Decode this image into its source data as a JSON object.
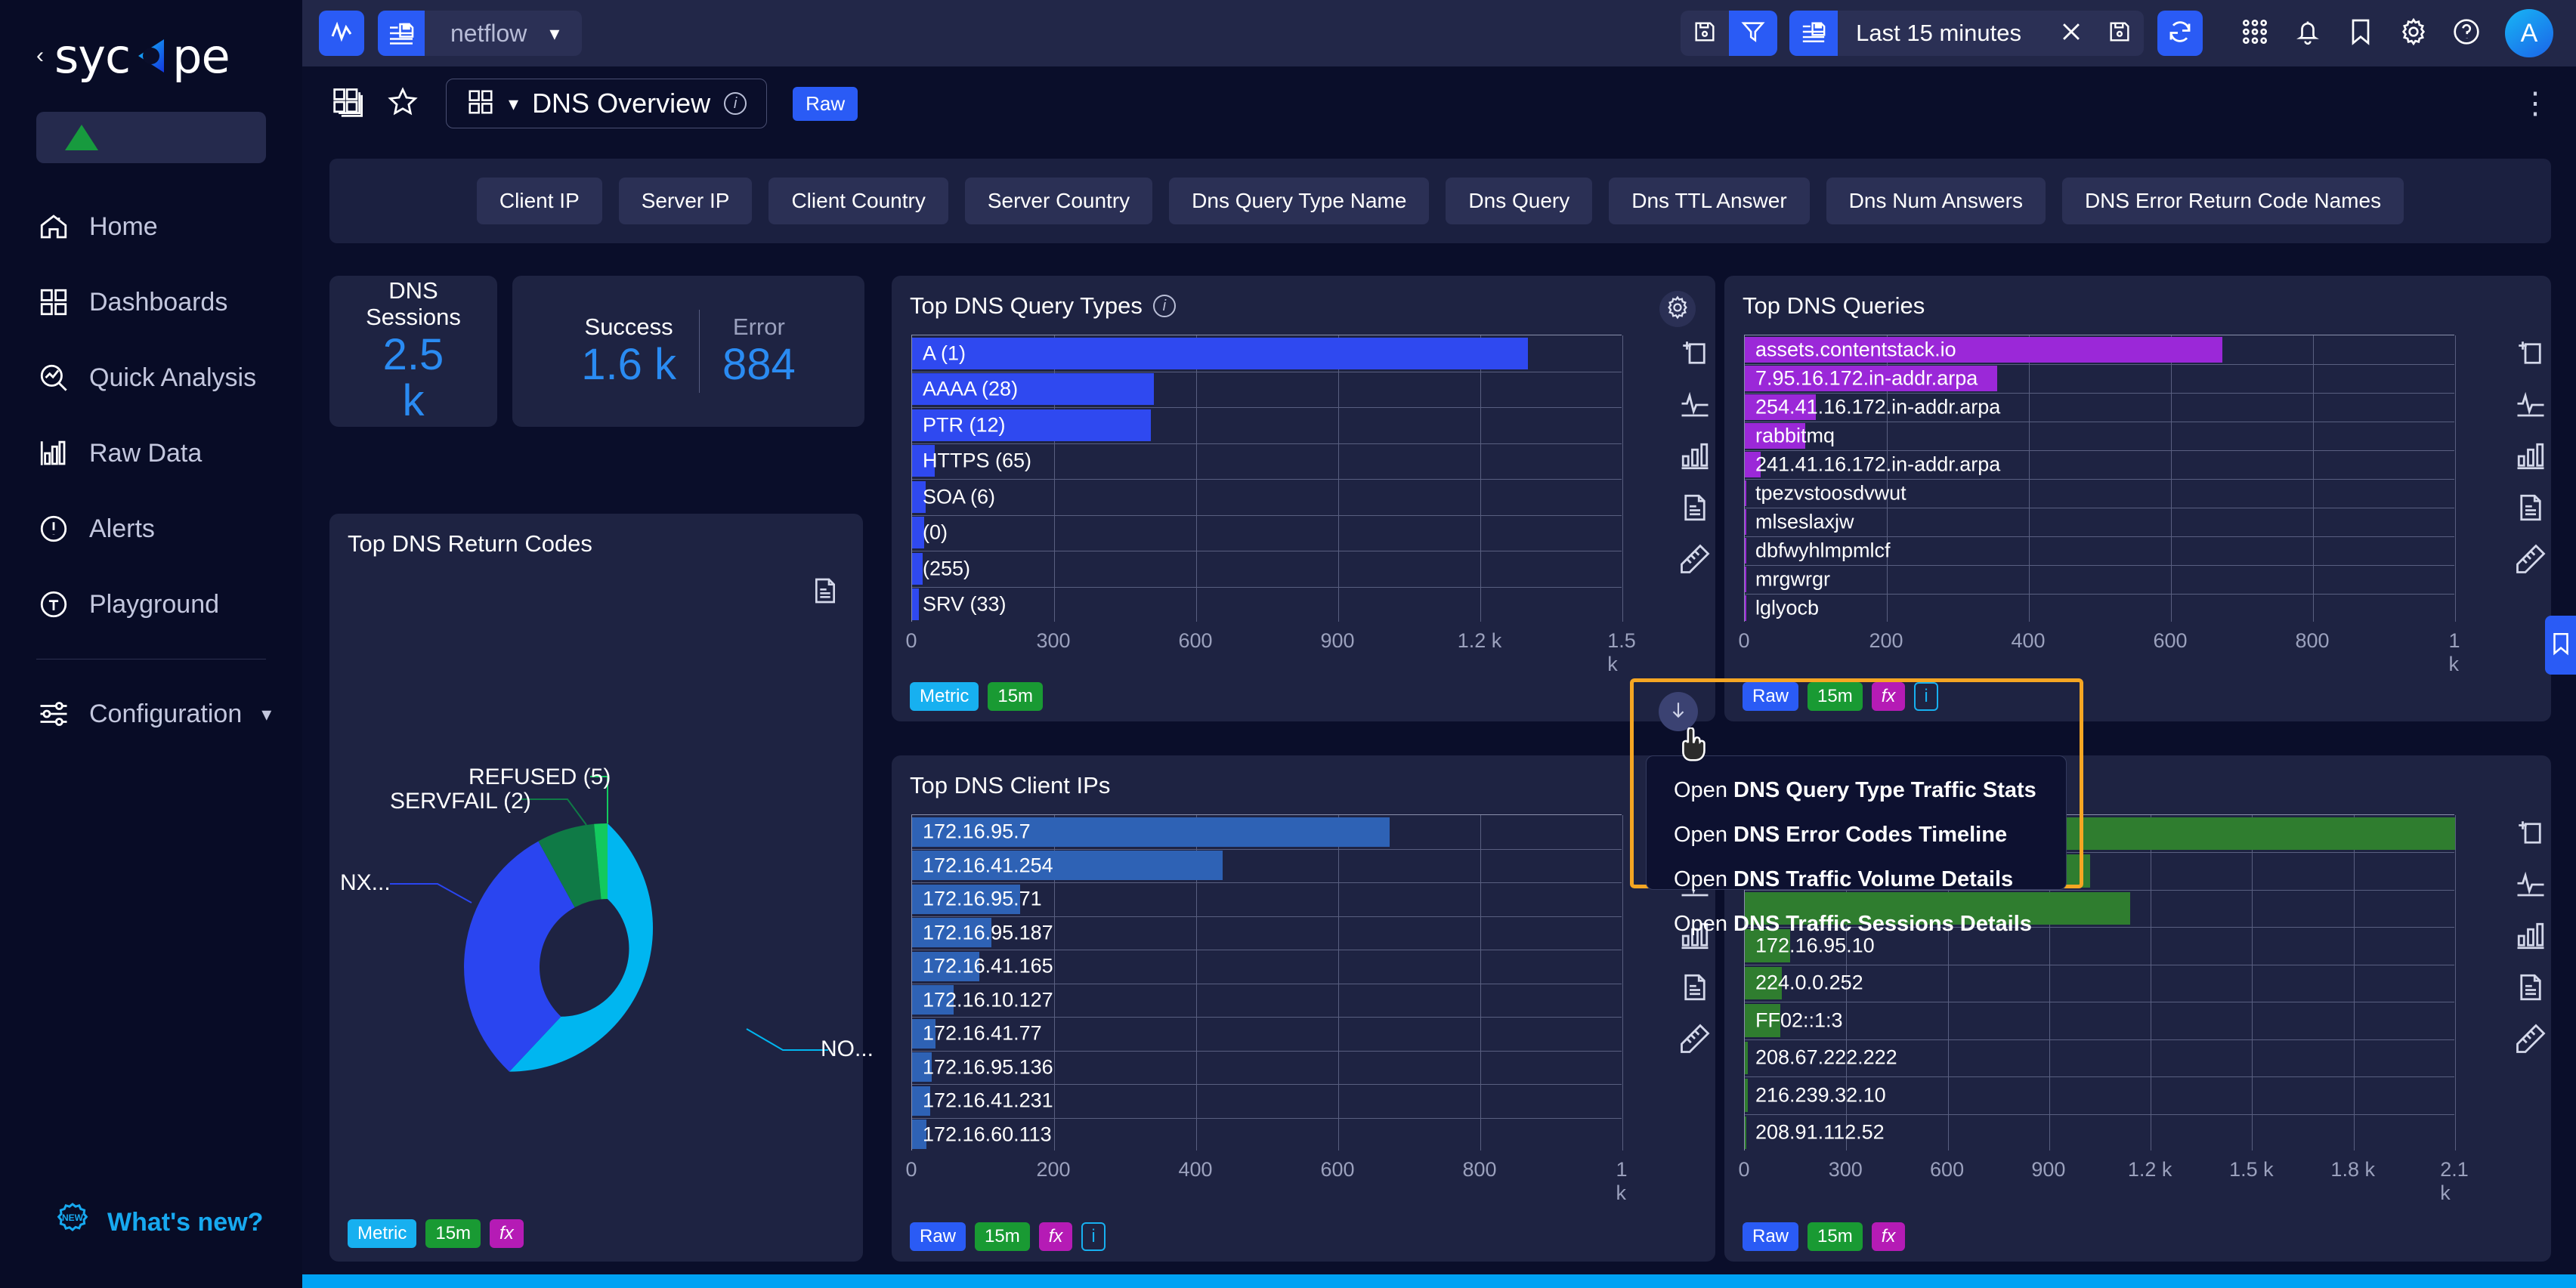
{
  "brand": {
    "name": "sycope",
    "collapse_icon": "chevron-left-icon"
  },
  "sidebar": {
    "items": [
      {
        "label": "Home",
        "icon": "home-icon"
      },
      {
        "label": "Dashboards",
        "icon": "grid-icon"
      },
      {
        "label": "Quick Analysis",
        "icon": "analysis-search-icon"
      },
      {
        "label": "Raw Data",
        "icon": "bars-icon"
      },
      {
        "label": "Alerts",
        "icon": "alert-icon"
      },
      {
        "label": "Playground",
        "icon": "playground-icon"
      },
      {
        "label": "Configuration",
        "icon": "sliders-icon"
      }
    ],
    "whats_new": "What's new?"
  },
  "topbar": {
    "pulse_icon": "pulse-icon",
    "source_icon": "saved-query-icon",
    "source_label": "netflow",
    "source_chevron": "chevron-down-icon",
    "save_filter_icon": "save-icon",
    "filter_icon": "filter-icon",
    "time_icon": "saved-time-icon",
    "time_label": "Last 15 minutes",
    "clear_icon": "close-icon",
    "save_time_icon": "save-icon",
    "refresh_icon": "refresh-icon",
    "apps_icon": "apps-grid-icon",
    "bell_icon": "bell-icon",
    "bookmark_icon": "bookmark-icon",
    "gear_icon": "gear-icon",
    "help_icon": "help-icon",
    "avatar_initial": "A"
  },
  "dashboard_header": {
    "layout_icon": "layouts-icon",
    "star_icon": "star-icon",
    "grid_icon": "grid-small-icon",
    "chevron": "chevron-down-icon",
    "title": "DNS Overview",
    "info_icon": "info-icon",
    "raw_badge": "Raw",
    "kebab": "⋮"
  },
  "filter_chips": [
    "Client IP",
    "Server IP",
    "Client Country",
    "Server Country",
    "Dns Query Type Name",
    "Dns Query",
    "Dns TTL Answer",
    "Dns Num Answers",
    "DNS Error Return Code Names"
  ],
  "kpi": {
    "sessions": {
      "label_line1": "DNS",
      "label_line2": "Sessions",
      "value": "2.5",
      "unit": "k"
    },
    "success": {
      "label": "Success",
      "value": "1.6 k"
    },
    "error": {
      "label": "Error",
      "value": "884"
    }
  },
  "panels": {
    "query_types": {
      "title": "Top DNS Query Types",
      "gear_icon": "gear-icon",
      "info_icon": "info-icon"
    },
    "queries": {
      "title": "Top DNS Queries"
    },
    "return_codes": {
      "title": "Top DNS Return Codes",
      "doc_icon": "document-icon"
    },
    "client_ips": {
      "title": "Top DNS Client IPs"
    },
    "server_ips": {
      "title": ""
    }
  },
  "badges": {
    "raw": "Raw",
    "metric": "Metric",
    "m15": "15m",
    "fx": "fx",
    "info": "i"
  },
  "context_menu": {
    "items": [
      {
        "prefix": "Open",
        "label": "DNS Query Type Traffic Stats"
      },
      {
        "prefix": "Open",
        "label": "DNS Error Codes Timeline"
      },
      {
        "prefix": "Open",
        "label": "DNS Traffic Volume Details"
      },
      {
        "prefix": "Open",
        "label": "DNS Traffic Sessions Details"
      }
    ]
  },
  "side_tools": [
    "add-widget-icon",
    "line-chart-icon",
    "bar-chart-icon",
    "table-icon",
    "edit-ruler-icon"
  ],
  "colors": {
    "accent_blue": "#2a5bf5",
    "bar_blue": "#2f49f0",
    "bar_purple": "#9b28d8",
    "bar_steel": "#2e62b5",
    "bar_green": "#2f7d2f",
    "highlight": "#f5a623",
    "kpi_value": "#2a8bf2",
    "donut_cyan": "#00b6f0",
    "donut_blue": "#2a45f0",
    "donut_darkgreen": "#0f7a46",
    "donut_green": "#13c95e"
  },
  "chart_data": [
    {
      "type": "bar",
      "title": "Top DNS Query Types",
      "orientation": "horizontal",
      "categories": [
        "A (1)",
        "AAAA (28)",
        "PTR (12)",
        "HTTPS (65)",
        "SOA (6)",
        " (0)",
        " (255)",
        "SRV (33)"
      ],
      "values": [
        1300,
        510,
        505,
        48,
        28,
        25,
        22,
        14
      ],
      "xlabel": "",
      "ylabel": "",
      "xticks": [
        "0",
        "300",
        "600",
        "900",
        "1.2 k",
        "1.5 k"
      ],
      "xlim": [
        0,
        1500
      ],
      "grid": true,
      "legend": false,
      "bar_color": "#2f49f0",
      "badges": [
        "Metric",
        "15m"
      ]
    },
    {
      "type": "bar",
      "title": "Top DNS Queries",
      "orientation": "horizontal",
      "categories": [
        "assets.contentstack.io",
        "7.95.16.172.in-addr.arpa",
        "254.41.16.172.in-addr.arpa",
        "rabbitmq",
        "241.41.16.172.in-addr.arpa",
        "tpezvstoosdvwut",
        "mlseslaxjw",
        "dbfwyhlmpmlcf",
        "mrgwrgr",
        "lglyocb"
      ],
      "values": [
        672,
        355,
        100,
        85,
        22,
        2,
        2,
        2,
        2,
        2
      ],
      "xticks": [
        "0",
        "200",
        "400",
        "600",
        "800",
        "1 k"
      ],
      "xlim": [
        0,
        1000
      ],
      "grid": true,
      "legend": false,
      "bar_color": "#9b28d8",
      "badges": [
        "Raw",
        "15m",
        "fx",
        "i"
      ]
    },
    {
      "type": "pie",
      "title": "Top DNS Return Codes",
      "donut": true,
      "labels": [
        "NOERROR",
        "NXDOMAIN",
        "SERVFAIL (2)",
        "REFUSED (5)"
      ],
      "display_labels": [
        "NO...",
        "NX...",
        "SERVFAIL (2)",
        "REFUSED (5)"
      ],
      "values": [
        62,
        30,
        6.5,
        1.5
      ],
      "colors": [
        "#00b6f0",
        "#2a45f0",
        "#0f7a46",
        "#13c95e"
      ],
      "legend": false,
      "badges": [
        "Metric",
        "15m",
        "fx"
      ]
    },
    {
      "type": "bar",
      "title": "Top DNS Client IPs",
      "orientation": "horizontal",
      "categories": [
        "172.16.95.7",
        "172.16.41.254",
        "172.16.95.71",
        "172.16.95.187",
        "172.16.41.165",
        "172.16.10.127",
        "172.16.41.77",
        "172.16.95.136",
        "172.16.41.231",
        "172.16.60.113"
      ],
      "values": [
        672,
        437,
        152,
        112,
        95,
        58,
        33,
        28,
        26,
        20
      ],
      "xticks": [
        "0",
        "200",
        "400",
        "600",
        "800",
        "1 k"
      ],
      "xlim": [
        0,
        1000
      ],
      "grid": true,
      "legend": false,
      "bar_color": "#2e62b5",
      "badges": [
        "Raw",
        "15m",
        "fx",
        "i"
      ]
    },
    {
      "type": "bar",
      "title": "",
      "orientation": "horizontal",
      "categories": [
        "",
        "",
        "",
        "172.16.95.10",
        "224.0.0.252",
        "FF02::1:3",
        "208.67.222.222",
        "216.239.32.10",
        "208.91.112.52"
      ],
      "values": [
        2100,
        1020,
        1140,
        135,
        110,
        105,
        8,
        8,
        3
      ],
      "xticks": [
        "0",
        "300",
        "600",
        "900",
        "1.2 k",
        "1.5 k",
        "1.8 k",
        "2.1 k"
      ],
      "xlim": [
        0,
        2100
      ],
      "grid": true,
      "legend": false,
      "bar_color": "#2f7d2f",
      "badges": [
        "Raw",
        "15m",
        "fx"
      ]
    }
  ]
}
